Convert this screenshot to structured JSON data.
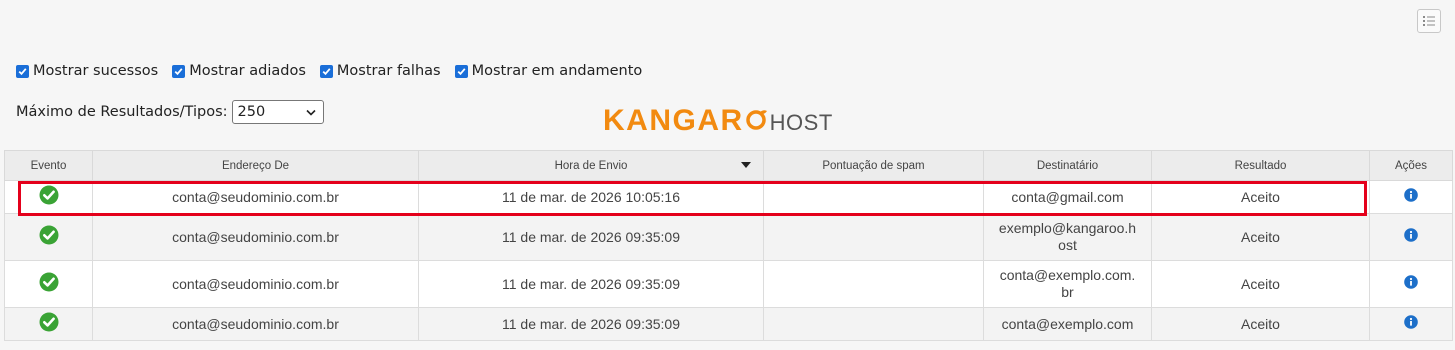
{
  "filters": [
    {
      "label": "Mostrar sucessos",
      "checked": true
    },
    {
      "label": "Mostrar adiados",
      "checked": true
    },
    {
      "label": "Mostrar falhas",
      "checked": true
    },
    {
      "label": "Mostrar em andamento",
      "checked": true
    }
  ],
  "max_results": {
    "label": "Máximo de Resultados/Tipos:",
    "value": "250"
  },
  "logo": {
    "kangaroo": "KANGAROO",
    "kangaroo_pre": "KANGAR",
    "host": "HOST"
  },
  "table": {
    "headers": {
      "evento": "Evento",
      "endereco_de": "Endereço De",
      "hora_de_envio": "Hora de Envio",
      "pontuacao_spam": "Pontuação de spam",
      "destinatario": "Destinatário",
      "resultado": "Resultado",
      "acoes": "Ações"
    },
    "sorted_column": "Hora de Envio",
    "sort_direction": "descending",
    "rows": [
      {
        "evento": "success-icon",
        "endereco_de": "conta@seudominio.com.br",
        "hora_de_envio": "11 de mar. de 2026 10:05:16",
        "pontuacao_spam": "",
        "destinatario": "conta@gmail.com",
        "resultado": "Aceito",
        "acoes": "info-icon"
      },
      {
        "evento": "success-icon",
        "endereco_de": "conta@seudominio.com.br",
        "hora_de_envio": "11 de mar. de 2026 09:35:09",
        "pontuacao_spam": "",
        "destinatario": "exemplo@kangaroo.h\nost",
        "resultado": "Aceito",
        "acoes": "info-icon"
      },
      {
        "evento": "success-icon",
        "endereco_de": "conta@seudominio.com.br",
        "hora_de_envio": "11 de mar. de 2026 09:35:09",
        "pontuacao_spam": "",
        "destinatario": "conta@exemplo.com.\nbr",
        "resultado": "Aceito",
        "acoes": "info-icon"
      },
      {
        "evento": "success-icon",
        "endereco_de": "conta@seudominio.com.br",
        "hora_de_envio": "11 de mar. de 2026 09:35:09",
        "pontuacao_spam": "",
        "destinatario": "conta@exemplo.com",
        "resultado": "Aceito",
        "acoes": "info-icon"
      }
    ]
  },
  "colors": {
    "checkbox": "#1a6ed8",
    "success": "#3aa335",
    "info": "#1d6fc9",
    "highlight": "#e4001b",
    "logo_orange": "#f28a10",
    "logo_gray": "#555555"
  }
}
